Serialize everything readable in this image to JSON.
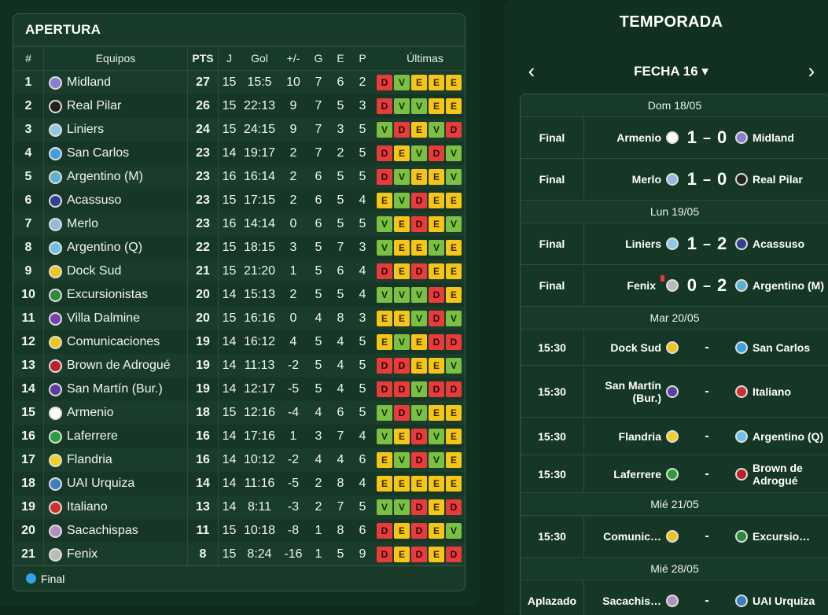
{
  "standings": {
    "title": "APERTURA",
    "headers": [
      "#",
      "Equipos",
      "PTS",
      "J",
      "Gol",
      "+/-",
      "G",
      "E",
      "P",
      "Últimas"
    ],
    "legend": "Final",
    "rows": [
      {
        "pos": "1",
        "team": "Midland",
        "pts": "27",
        "j": "15",
        "gol": "15:5",
        "dif": "10",
        "g": "7",
        "e": "6",
        "p": "2",
        "form": [
          "D",
          "V",
          "E",
          "E",
          "E"
        ],
        "crest": "#8a7fd0",
        "final": true
      },
      {
        "pos": "2",
        "team": "Real Pilar",
        "pts": "26",
        "j": "15",
        "gol": "22:13",
        "dif": "9",
        "g": "7",
        "e": "5",
        "p": "3",
        "form": [
          "D",
          "V",
          "V",
          "E",
          "E"
        ],
        "crest": "#222222"
      },
      {
        "pos": "3",
        "team": "Liniers",
        "pts": "24",
        "j": "15",
        "gol": "24:15",
        "dif": "9",
        "g": "7",
        "e": "3",
        "p": "5",
        "form": [
          "V",
          "D",
          "E",
          "V",
          "D"
        ],
        "crest": "#8ec7e8"
      },
      {
        "pos": "4",
        "team": "San Carlos",
        "pts": "23",
        "j": "14",
        "gol": "19:17",
        "dif": "2",
        "g": "7",
        "e": "2",
        "p": "5",
        "form": [
          "D",
          "E",
          "V",
          "D",
          "V"
        ],
        "crest": "#3fa0e0"
      },
      {
        "pos": "5",
        "team": "Argentino (M)",
        "pts": "23",
        "j": "16",
        "gol": "16:14",
        "dif": "2",
        "g": "6",
        "e": "5",
        "p": "5",
        "form": [
          "D",
          "V",
          "E",
          "E",
          "V"
        ],
        "crest": "#5ab0d0"
      },
      {
        "pos": "6",
        "team": "Acassuso",
        "pts": "23",
        "j": "15",
        "gol": "17:15",
        "dif": "2",
        "g": "6",
        "e": "5",
        "p": "4",
        "form": [
          "E",
          "V",
          "D",
          "E",
          "E"
        ],
        "crest": "#34418f"
      },
      {
        "pos": "7",
        "team": "Merlo",
        "pts": "23",
        "j": "16",
        "gol": "14:14",
        "dif": "0",
        "g": "6",
        "e": "5",
        "p": "5",
        "form": [
          "V",
          "E",
          "D",
          "E",
          "V"
        ],
        "crest": "#9ab7e0"
      },
      {
        "pos": "8",
        "team": "Argentino (Q)",
        "pts": "22",
        "j": "15",
        "gol": "18:15",
        "dif": "3",
        "g": "5",
        "e": "7",
        "p": "3",
        "form": [
          "V",
          "E",
          "E",
          "V",
          "E"
        ],
        "crest": "#6fc0e8"
      },
      {
        "pos": "9",
        "team": "Dock Sud",
        "pts": "21",
        "j": "15",
        "gol": "21:20",
        "dif": "1",
        "g": "5",
        "e": "6",
        "p": "4",
        "form": [
          "D",
          "E",
          "D",
          "E",
          "E"
        ],
        "crest": "#f0c419"
      },
      {
        "pos": "10",
        "team": "Excursionistas",
        "pts": "20",
        "j": "14",
        "gol": "15:13",
        "dif": "2",
        "g": "5",
        "e": "5",
        "p": "4",
        "form": [
          "V",
          "V",
          "V",
          "D",
          "E"
        ],
        "crest": "#2e8b3a"
      },
      {
        "pos": "11",
        "team": "Villa Dalmine",
        "pts": "20",
        "j": "15",
        "gol": "16:16",
        "dif": "0",
        "g": "4",
        "e": "8",
        "p": "3",
        "form": [
          "E",
          "E",
          "V",
          "D",
          "V"
        ],
        "crest": "#7b3fb0"
      },
      {
        "pos": "12",
        "team": "Comunicaciones",
        "pts": "19",
        "j": "14",
        "gol": "16:12",
        "dif": "4",
        "g": "5",
        "e": "4",
        "p": "5",
        "form": [
          "E",
          "V",
          "E",
          "D",
          "D"
        ],
        "crest": "#f0c419"
      },
      {
        "pos": "13",
        "team": "Brown de Adrogué",
        "pts": "19",
        "j": "14",
        "gol": "11:13",
        "dif": "-2",
        "g": "5",
        "e": "4",
        "p": "5",
        "form": [
          "D",
          "D",
          "E",
          "E",
          "V"
        ],
        "crest": "#c0202a"
      },
      {
        "pos": "14",
        "team": "San Martín (Bur.)",
        "pts": "19",
        "j": "14",
        "gol": "12:17",
        "dif": "-5",
        "g": "5",
        "e": "4",
        "p": "5",
        "form": [
          "D",
          "D",
          "V",
          "D",
          "D"
        ],
        "crest": "#5a3fa0"
      },
      {
        "pos": "15",
        "team": "Armenio",
        "pts": "18",
        "j": "15",
        "gol": "12:16",
        "dif": "-4",
        "g": "4",
        "e": "6",
        "p": "5",
        "form": [
          "V",
          "D",
          "V",
          "E",
          "E"
        ],
        "crest": "#ffffff"
      },
      {
        "pos": "16",
        "team": "Laferrere",
        "pts": "16",
        "j": "14",
        "gol": "17:16",
        "dif": "1",
        "g": "3",
        "e": "7",
        "p": "4",
        "form": [
          "V",
          "E",
          "D",
          "V",
          "E"
        ],
        "crest": "#2e9b40"
      },
      {
        "pos": "17",
        "team": "Flandria",
        "pts": "16",
        "j": "14",
        "gol": "10:12",
        "dif": "-2",
        "g": "4",
        "e": "4",
        "p": "6",
        "form": [
          "E",
          "V",
          "D",
          "V",
          "E"
        ],
        "crest": "#f0d020"
      },
      {
        "pos": "18",
        "team": "UAI Urquiza",
        "pts": "14",
        "j": "14",
        "gol": "11:16",
        "dif": "-5",
        "g": "2",
        "e": "8",
        "p": "4",
        "form": [
          "E",
          "E",
          "E",
          "E",
          "E"
        ],
        "crest": "#3a7fc0"
      },
      {
        "pos": "19",
        "team": "Italiano",
        "pts": "13",
        "j": "14",
        "gol": "8:11",
        "dif": "-3",
        "g": "2",
        "e": "7",
        "p": "5",
        "form": [
          "V",
          "V",
          "D",
          "E",
          "D"
        ],
        "crest": "#d03030"
      },
      {
        "pos": "20",
        "team": "Sacachispas",
        "pts": "11",
        "j": "15",
        "gol": "10:18",
        "dif": "-8",
        "g": "1",
        "e": "8",
        "p": "6",
        "form": [
          "D",
          "E",
          "D",
          "E",
          "V"
        ],
        "crest": "#b090c0"
      },
      {
        "pos": "21",
        "team": "Fenix",
        "pts": "8",
        "j": "15",
        "gol": "8:24",
        "dif": "-16",
        "g": "1",
        "e": "5",
        "p": "9",
        "form": [
          "D",
          "E",
          "D",
          "E",
          "D"
        ],
        "crest": "#bbbbbb"
      }
    ]
  },
  "season": {
    "title": "TEMPORADA",
    "round": "FECHA 16 ▾",
    "prev_arrow": "‹",
    "next_arrow": "›",
    "days": [
      {
        "date": "Dom 18/05",
        "matches": [
          {
            "status": "Final",
            "home": "Armenio",
            "home_crest": "#ffffff",
            "score_home": "1",
            "score_away": "0",
            "away": "Midland",
            "away_crest": "#8a7fd0"
          },
          {
            "status": "Final",
            "home": "Merlo",
            "home_crest": "#9ab7e0",
            "score_home": "1",
            "score_away": "0",
            "away": "Real Pilar",
            "away_crest": "#222222"
          }
        ]
      },
      {
        "date": "Lun 19/05",
        "matches": [
          {
            "status": "Final",
            "home": "Liniers",
            "home_crest": "#8ec7e8",
            "score_home": "1",
            "score_away": "2",
            "away": "Acassuso",
            "away_crest": "#34418f"
          },
          {
            "status": "Final",
            "home": "Fenix",
            "home_crest": "#bbbbbb",
            "score_home": "0",
            "score_away": "2",
            "away": "Argentino (M)",
            "away_crest": "#5ab0d0",
            "red_card": true
          }
        ]
      },
      {
        "date": "Mar 20/05",
        "matches": [
          {
            "status": "15:30",
            "home": "Dock Sud",
            "home_crest": "#f0c419",
            "away": "San Carlos",
            "away_crest": "#3fa0e0"
          },
          {
            "status": "15:30",
            "home": "San Martín (Bur.)",
            "home_crest": "#5a3fa0",
            "away": "Italiano",
            "away_crest": "#d03030"
          },
          {
            "status": "15:30",
            "home": "Flandria",
            "home_crest": "#f0d020",
            "away": "Argentino (Q)",
            "away_crest": "#6fc0e8"
          },
          {
            "status": "15:30",
            "home": "Laferrere",
            "home_crest": "#2e9b40",
            "away": "Brown de Adrogué",
            "away_crest": "#c0202a"
          }
        ]
      },
      {
        "date": "Mié 21/05",
        "matches": [
          {
            "status": "15:30",
            "home": "Comunic…",
            "home_crest": "#f0c419",
            "away": "Excursio…",
            "away_crest": "#2e8b3a"
          }
        ]
      },
      {
        "date": "Mié 28/05",
        "matches": [
          {
            "status": "Aplazado",
            "home": "Sacachis…",
            "home_crest": "#b090c0",
            "away": "UAI Urquiza",
            "away_crest": "#3a7fc0"
          }
        ]
      }
    ],
    "pending_separator": "-"
  }
}
